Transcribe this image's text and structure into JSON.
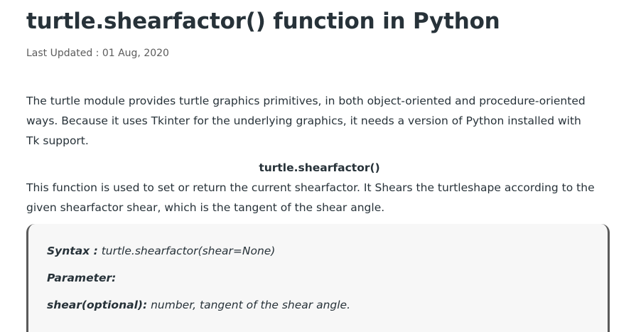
{
  "article": {
    "title": "turtle.shearfactor() function in Python",
    "last_updated": "Last Updated : 01 Aug, 2020",
    "intro": "The turtle module provides turtle graphics primitives, in both object-oriented and procedure-oriented ways. Because it uses Tkinter for the underlying graphics, it needs a version of Python installed with Tk support.",
    "subheading": "turtle.shearfactor()",
    "description": "This function is used to set or return the current shearfactor. It Shears the turtleshape according to the given shearfactor shear, which is the tangent of the shear angle."
  },
  "code_box": {
    "syntax_label": "Syntax :",
    "syntax_value": " turtle.shearfactor(shear=None)",
    "parameter_label": "Parameter:",
    "param_name": "shear(optional):",
    "param_desc": " number, tangent of the shear angle."
  }
}
